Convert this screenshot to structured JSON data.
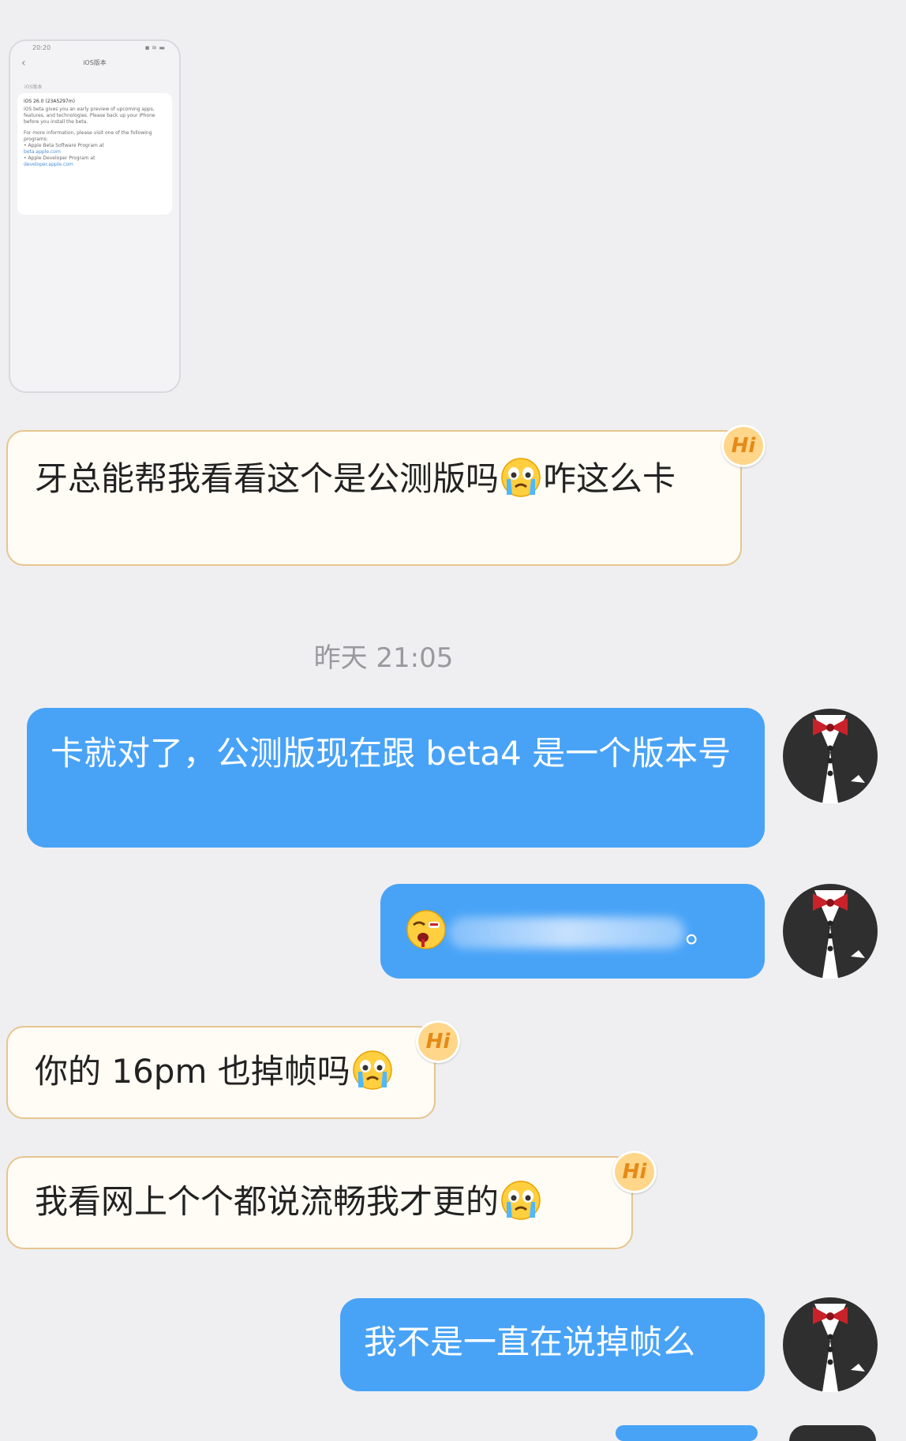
{
  "thumbnail": {
    "status_time": "20:20",
    "status_icons": "◾ ≋ ▬",
    "title": "iOS版本",
    "section": "iOS版本",
    "card_heading": "iOS 26.0 (23A5297m)",
    "card_body": "iOS beta gives you an early preview of upcoming apps, features, and technologies. Please back up your iPhone before you install the beta.",
    "card_info": "For more information, please visit one of the following programs:",
    "program_1": "• Apple Beta Software Program at",
    "link_1": "beta.apple.com",
    "program_2": "• Apple Developer Program at",
    "link_2": "developer.apple.com"
  },
  "messages": {
    "m1_text_a": "牙总能帮我看看这个是公测版吗",
    "m1_text_b": "咋这么卡",
    "timestamp": "昨天 21:05",
    "m2_text": "卡就对了，公测版现在跟 beta4 是一个版本号",
    "m3_tail": "。",
    "m4_text": "你的 16pm 也掉帧吗",
    "m5_text": "我看网上个个都说流畅我才更的",
    "m6_text": "我不是一直在说掉帧么",
    "hi_label": "Hi"
  },
  "icons": {
    "crying": "crying-face-emoji",
    "tongue": "bleeding-face-emoji",
    "avatar": "tuxedo-avatar"
  }
}
